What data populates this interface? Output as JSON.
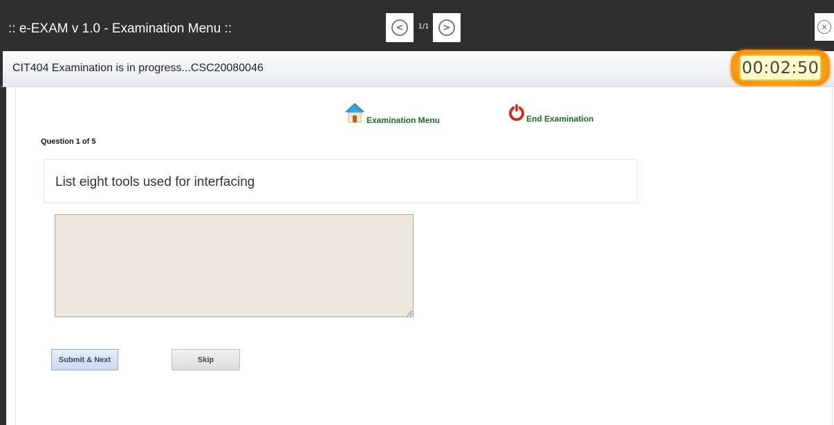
{
  "window": {
    "title": ":: e-EXAM v 1.0 - Examination Menu ::",
    "page_indicator": "1/1",
    "prev_glyph": "<",
    "next_glyph": ">",
    "close_glyph": "×"
  },
  "status": {
    "text": "CIT404 Examination is in progress...CSC20080046",
    "timer": "00:02:50"
  },
  "menu": {
    "exam_menu_label": "Examination Menu",
    "end_exam_label": "End Examination"
  },
  "question": {
    "counter": "Question 1 of 5",
    "text": "List eight tools used for interfacing"
  },
  "answer": {
    "value": ""
  },
  "buttons": {
    "submit_label": "Submit & Next",
    "skip_label": "Skip"
  },
  "icons": {
    "home": "home-icon",
    "power": "power-icon"
  },
  "colors": {
    "titlebar": "#2f2f2f",
    "menu_link": "#1e6b24",
    "timer_ring": "#f7a21b",
    "answer_bg": "#ece8df"
  }
}
